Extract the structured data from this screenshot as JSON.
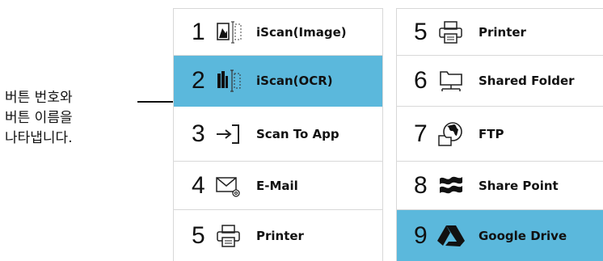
{
  "callout": {
    "lines": [
      "버튼 번호와",
      "버튼 이름을",
      "나타냅니다."
    ]
  },
  "left_panel": {
    "buttons": [
      {
        "number": "1",
        "label": "iScan(Image)",
        "icon": "scan-image-icon",
        "selected": false
      },
      {
        "number": "2",
        "label": "iScan(OCR)",
        "icon": "scan-ocr-icon",
        "selected": true
      },
      {
        "number": "3",
        "label": "Scan To App",
        "icon": "scan-to-app-icon",
        "selected": false
      },
      {
        "number": "4",
        "label": "E-Mail",
        "icon": "email-icon",
        "selected": false
      },
      {
        "number": "5",
        "label": "Printer",
        "icon": "printer-icon",
        "selected": false
      }
    ]
  },
  "right_panel": {
    "buttons": [
      {
        "number": "5",
        "label": "Printer",
        "icon": "printer-icon",
        "selected": false
      },
      {
        "number": "6",
        "label": "Shared Folder",
        "icon": "shared-folder-icon",
        "selected": false
      },
      {
        "number": "7",
        "label": "FTP",
        "icon": "ftp-globe-icon",
        "selected": false
      },
      {
        "number": "8",
        "label": "Share Point",
        "icon": "sharepoint-icon",
        "selected": false
      },
      {
        "number": "9",
        "label": "Google Drive",
        "icon": "google-drive-icon",
        "selected": true
      }
    ]
  },
  "colors": {
    "selected": "#5bb8dc",
    "border": "#d8d8d8"
  }
}
